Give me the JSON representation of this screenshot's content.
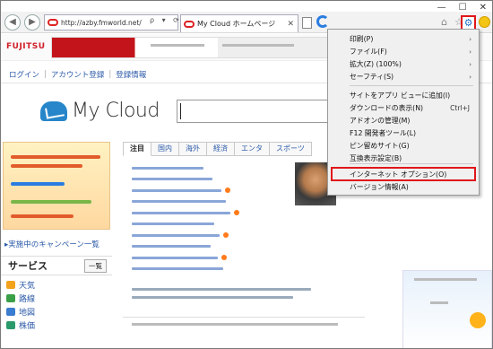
{
  "window": {
    "minimize": "—",
    "maximize": "☐",
    "close": "✕"
  },
  "nav": {
    "back_icon": "◀",
    "forward_icon": "▶",
    "url": "http://azby.fmworld.net/",
    "addr_tools": "ρ ▾ ⟳",
    "tab_title": "My Cloud ホームページ",
    "tab_close": "✕",
    "home_icon": "⌂",
    "star_icon": "☆",
    "gear_icon": "⚙"
  },
  "banner": {
    "brand": "FUJITSU"
  },
  "login_bar": {
    "login": "ログイン",
    "register": "アカウント登録",
    "info": "登録情報"
  },
  "logo": {
    "text": "My Cloud"
  },
  "left": {
    "campaign": "▸実施中のキャンペーン一覧",
    "services_title": "サービス",
    "services_all": "一覧",
    "services": [
      {
        "label": "天気",
        "color": "#f3a21c"
      },
      {
        "label": "路線",
        "color": "#3aa048"
      },
      {
        "label": "地図",
        "color": "#3a7cd0"
      },
      {
        "label": "株価",
        "color": "#2a9a6a"
      }
    ]
  },
  "news": {
    "tabs": [
      "注目",
      "国内",
      "海外",
      "経済",
      "エンタ",
      "スポーツ"
    ]
  },
  "menu": {
    "items": [
      {
        "label": "印刷(P)",
        "arrow": "›"
      },
      {
        "label": "ファイル(F)",
        "arrow": "›"
      },
      {
        "label": "拡大(Z) (100%)",
        "arrow": "›"
      },
      {
        "label": "セーフティ(S)",
        "arrow": "›"
      },
      {
        "label": "サイトをアプリ ビューに追加(I)"
      },
      {
        "label": "ダウンロードの表示(N)",
        "shortcut": "Ctrl+J"
      },
      {
        "label": "アドオンの管理(M)"
      },
      {
        "label": "F12 開発者ツール(L)"
      },
      {
        "label": "ピン留めサイト(G)"
      },
      {
        "label": "互換表示設定(B)"
      },
      {
        "label": "インターネット オプション(O)"
      },
      {
        "label": "バージョン情報(A)"
      }
    ]
  },
  "colors": {
    "highlight": "#e0161a",
    "accent": "#1f72c8",
    "link": "#2b5aa8"
  }
}
